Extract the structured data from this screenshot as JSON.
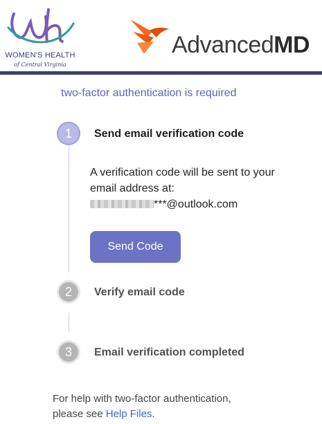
{
  "header": {
    "clinic_logo": {
      "name_line": "WOMEN'S HEALTH",
      "tagline": "of Central Virginia",
      "mark_color": "#7a5bb5"
    },
    "vendor_logo": {
      "name_regular": "Advanced",
      "name_bold": "MD",
      "bird_color": "#f26a22"
    },
    "rule_color": "#3a3f6e"
  },
  "subtitle": "two-factor authentication is required",
  "steps": [
    {
      "number": "1",
      "title": "Send email verification code",
      "state": "active",
      "body_line1": "A verification code will be sent to your",
      "body_line2": "email address at:",
      "email_suffix": "***@outlook.com",
      "button_label": "Send Code"
    },
    {
      "number": "2",
      "title": "Verify email code",
      "state": "inactive"
    },
    {
      "number": "3",
      "title": "Email verification completed",
      "state": "inactive"
    }
  ],
  "help": {
    "text_line1": "For help with two-factor authentication,",
    "text_line2_prefix": "please see ",
    "link_label": "Help Files",
    "text_suffix": "."
  },
  "colors": {
    "accent": "#6d73c4",
    "active_step": "#b7bbe6",
    "inactive_step": "#b5b5b5",
    "link": "#3a64c8"
  }
}
